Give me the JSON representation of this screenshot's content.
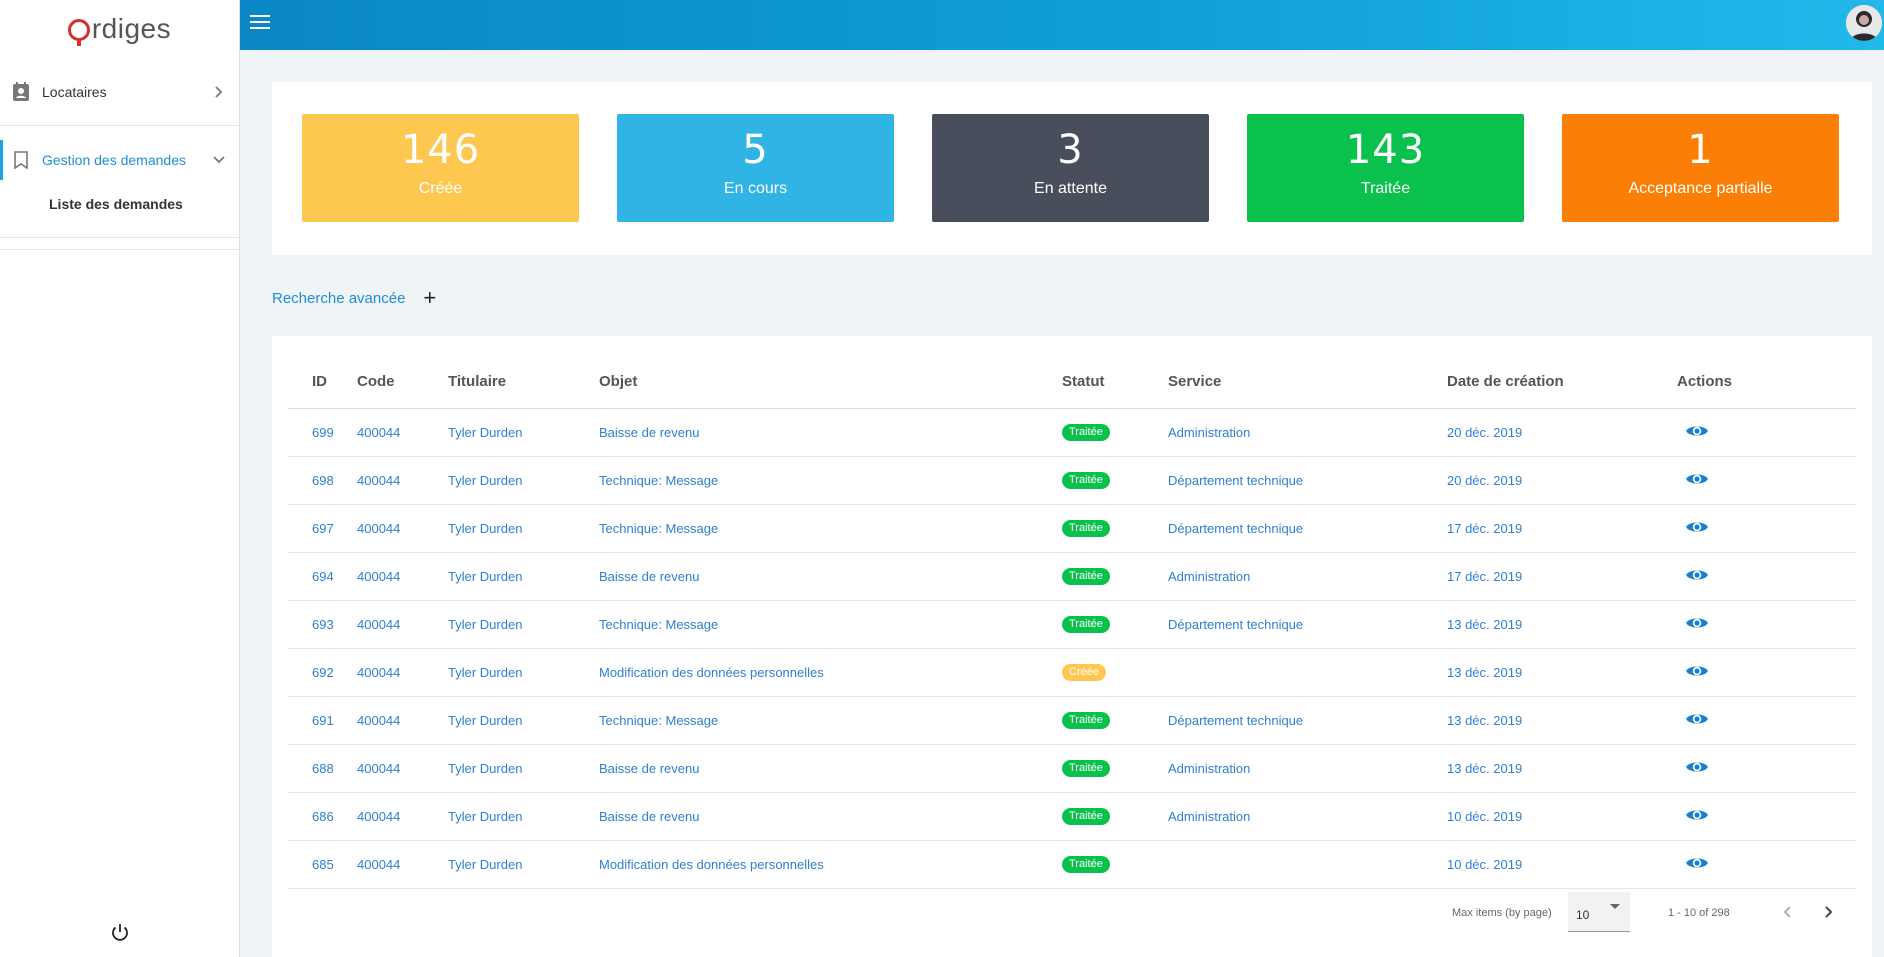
{
  "app": {
    "logo_text": "rdiges",
    "brand_color": "#d0312d",
    "accent": "#1aa3e0"
  },
  "sidebar": {
    "items": [
      {
        "label": "Locataires",
        "icon": "contact-card-icon"
      },
      {
        "label": "Gestion des demandes",
        "icon": "bookmark-icon"
      }
    ],
    "sub_items": [
      {
        "label": "Liste des demandes"
      }
    ]
  },
  "stats": [
    {
      "value": "146",
      "label": "Créée",
      "color": "#fdc750"
    },
    {
      "value": "5",
      "label": "En cours",
      "color": "#30b3e5"
    },
    {
      "value": "3",
      "label": "En attente",
      "color": "#484e5b"
    },
    {
      "value": "143",
      "label": "Traitée",
      "color": "#0ac14d"
    },
    {
      "value": "1",
      "label": "Acceptance partialle",
      "color": "#fb7e06"
    }
  ],
  "search": {
    "advanced_label": "Recherche avancée",
    "plus": "+"
  },
  "table": {
    "headers": [
      "ID",
      "Code",
      "Titulaire",
      "Objet",
      "Statut",
      "Service",
      "Date de création",
      "Actions"
    ],
    "rows": [
      {
        "id": "699",
        "code": "400044",
        "titulaire": "Tyler Durden",
        "objet": "Baisse de revenu",
        "statut": "Traitée",
        "service": "Administration",
        "date": "20 déc. 2019"
      },
      {
        "id": "698",
        "code": "400044",
        "titulaire": "Tyler Durden",
        "objet": "Technique: Message",
        "statut": "Traitée",
        "service": "Département technique",
        "date": "20 déc. 2019"
      },
      {
        "id": "697",
        "code": "400044",
        "titulaire": "Tyler Durden",
        "objet": "Technique: Message",
        "statut": "Traitée",
        "service": "Département technique",
        "date": "17 déc. 2019"
      },
      {
        "id": "694",
        "code": "400044",
        "titulaire": "Tyler Durden",
        "objet": "Baisse de revenu",
        "statut": "Traitée",
        "service": "Administration",
        "date": "17 déc. 2019"
      },
      {
        "id": "693",
        "code": "400044",
        "titulaire": "Tyler Durden",
        "objet": "Technique: Message",
        "statut": "Traitée",
        "service": "Département technique",
        "date": "13 déc. 2019"
      },
      {
        "id": "692",
        "code": "400044",
        "titulaire": "Tyler Durden",
        "objet": "Modification des données personnelles",
        "statut": "Créée",
        "service": "",
        "date": "13 déc. 2019"
      },
      {
        "id": "691",
        "code": "400044",
        "titulaire": "Tyler Durden",
        "objet": "Technique: Message",
        "statut": "Traitée",
        "service": "Département technique",
        "date": "13 déc. 2019"
      },
      {
        "id": "688",
        "code": "400044",
        "titulaire": "Tyler Durden",
        "objet": "Baisse de revenu",
        "statut": "Traitée",
        "service": "Administration",
        "date": "13 déc. 2019"
      },
      {
        "id": "686",
        "code": "400044",
        "titulaire": "Tyler Durden",
        "objet": "Baisse de revenu",
        "statut": "Traitée",
        "service": "Administration",
        "date": "10 déc. 2019"
      },
      {
        "id": "685",
        "code": "400044",
        "titulaire": "Tyler Durden",
        "objet": "Modification des données personnelles",
        "statut": "Traitée",
        "service": "",
        "date": "10 déc. 2019"
      }
    ]
  },
  "pagination": {
    "max_items_label": "Max items (by page)",
    "page_size": "10",
    "range": "1 - 10 of 298"
  }
}
